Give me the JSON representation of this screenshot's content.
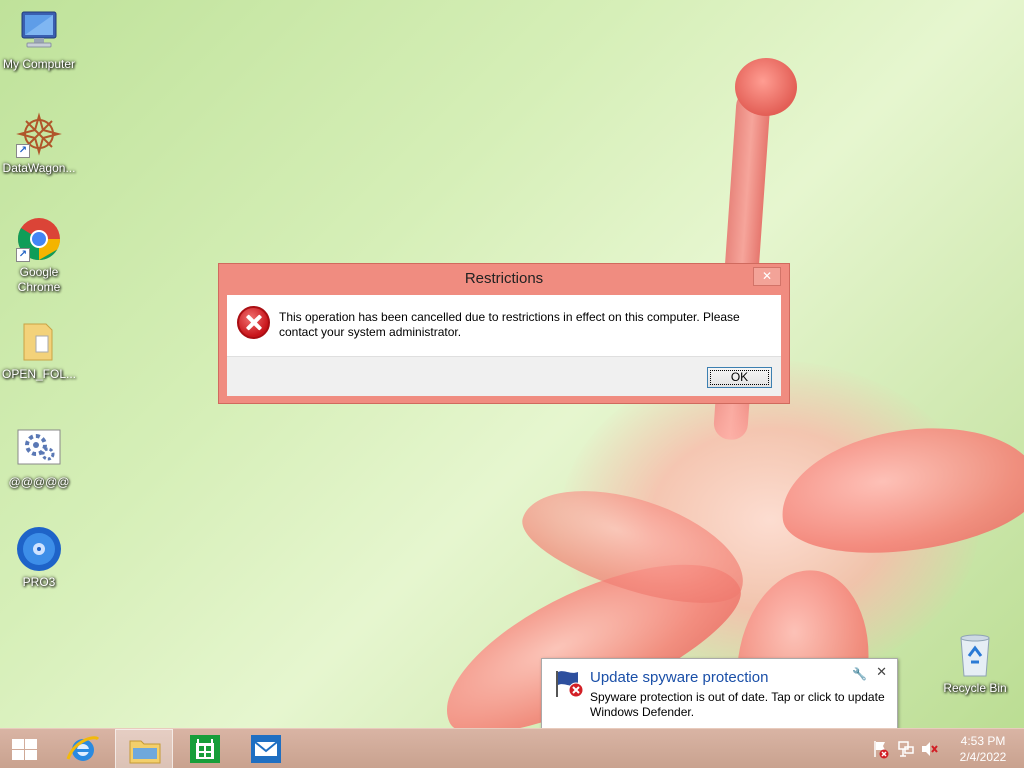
{
  "desktop": {
    "icons": [
      {
        "label": "My Computer",
        "icon": "computer-icon"
      },
      {
        "label": "DataWagon...",
        "icon": "datawagon-icon"
      },
      {
        "label": "Google Chrome",
        "icon": "chrome-icon"
      },
      {
        "label": "OPEN_FOL...",
        "icon": "folder-icon"
      },
      {
        "label": "@@@@@",
        "icon": "settings-file-icon"
      },
      {
        "label": "PRO3",
        "icon": "disc-icon"
      }
    ],
    "recycle_bin": {
      "label": "Recycle Bin",
      "icon": "recycle-bin-icon"
    }
  },
  "dialog": {
    "title": "Restrictions",
    "close_label": "✕",
    "message": "This operation has been cancelled due to restrictions in effect on this computer. Please contact your system administrator.",
    "ok_label": "OK",
    "icon": "error-icon"
  },
  "toast": {
    "title": "Update spyware protection",
    "text": "Spyware protection is out of date. Tap or click to update Windows Defender.",
    "icon": "defender-flag-icon",
    "settings_icon": "wrench-icon",
    "close_label": "✕"
  },
  "taskbar": {
    "apps": [
      {
        "name": "Internet Explorer",
        "icon": "ie-icon"
      },
      {
        "name": "File Explorer",
        "icon": "file-explorer-icon",
        "active": true
      },
      {
        "name": "Store",
        "icon": "store-icon"
      },
      {
        "name": "Mail",
        "icon": "mail-icon"
      }
    ],
    "tray_icons": [
      "action-center-icon",
      "network-icon",
      "volume-muted-icon"
    ],
    "clock": {
      "time": "4:53 PM",
      "date": "2/4/2022"
    }
  },
  "colors": {
    "dialog_frame": "#f08c80",
    "taskbar": "#d2ab99",
    "toast_title": "#1a4fa8",
    "error_red": "#c8141a"
  }
}
